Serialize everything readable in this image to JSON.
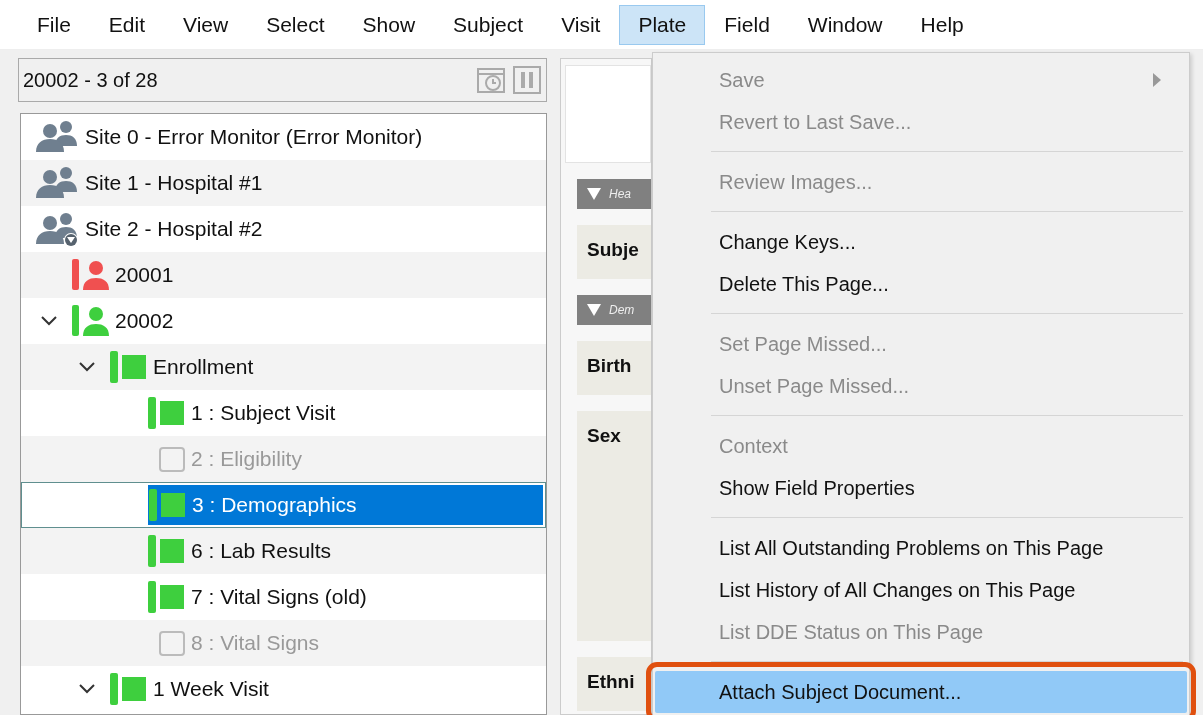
{
  "menubar": [
    {
      "label": "File",
      "selected": false
    },
    {
      "label": "Edit",
      "selected": false
    },
    {
      "label": "View",
      "selected": false
    },
    {
      "label": "Select",
      "selected": false
    },
    {
      "label": "Show",
      "selected": false
    },
    {
      "label": "Subject",
      "selected": false
    },
    {
      "label": "Visit",
      "selected": false
    },
    {
      "label": "Plate",
      "selected": true
    },
    {
      "label": "Field",
      "selected": false
    },
    {
      "label": "Window",
      "selected": false
    },
    {
      "label": "Help",
      "selected": false
    }
  ],
  "navigator": {
    "position": "20002 - 3 of 28"
  },
  "tree": [
    {
      "kind": "site",
      "label": "Site 0 - Error Monitor (Error Monitor)",
      "filtered": false,
      "selected": false
    },
    {
      "kind": "site",
      "label": "Site 1 - Hospital #1",
      "filtered": false,
      "selected": false
    },
    {
      "kind": "site",
      "label": "Site 2 - Hospital #2",
      "filtered": true,
      "selected": false,
      "children": [
        {
          "kind": "subject",
          "label": "20001",
          "color": "#f05050",
          "selected": false
        },
        {
          "kind": "subject",
          "label": "20002",
          "color": "#3ecf3e",
          "expanded": true,
          "selected": false,
          "children": [
            {
              "kind": "visit",
              "label": "Enrollment",
              "color": "#3ecf3e",
              "expanded": true,
              "selected": false,
              "children": [
                {
                  "kind": "page",
                  "label": "1 : Subject Visit",
                  "color": "#3ecf3e",
                  "missing": false,
                  "selected": false
                },
                {
                  "kind": "page",
                  "label": "2 : Eligibility",
                  "missing": true,
                  "selected": false
                },
                {
                  "kind": "page",
                  "label": "3 : Demographics",
                  "color": "#3ecf3e",
                  "missing": false,
                  "selected": true
                },
                {
                  "kind": "page",
                  "label": "6 : Lab Results",
                  "color": "#3ecf3e",
                  "missing": false,
                  "selected": false
                },
                {
                  "kind": "page",
                  "label": "7 : Vital Signs (old)",
                  "color": "#3ecf3e",
                  "missing": false,
                  "selected": false
                },
                {
                  "kind": "page",
                  "label": "8 : Vital Signs",
                  "missing": true,
                  "selected": false
                }
              ]
            },
            {
              "kind": "visit",
              "label": "1 Week Visit",
              "color": "#3ecf3e",
              "expanded": true,
              "selected": false
            }
          ]
        }
      ]
    }
  ],
  "form": {
    "sections": [
      {
        "title": "Hea",
        "fields": [
          {
            "label": "Subje",
            "kind": "text"
          }
        ]
      },
      {
        "title": "Dem",
        "fields": [
          {
            "label": "Birth",
            "kind": "text"
          },
          {
            "label": "Sex",
            "kind": "choice"
          },
          {
            "label": "Ethni",
            "kind": "text"
          }
        ]
      }
    ]
  },
  "plate_menu": [
    {
      "kind": "item",
      "label": "Save",
      "disabled": true,
      "submenu": true,
      "selected": false,
      "outlined": false
    },
    {
      "kind": "item",
      "label": "Revert to Last Save...",
      "disabled": true,
      "submenu": false,
      "selected": false,
      "outlined": false
    },
    {
      "kind": "separator"
    },
    {
      "kind": "item",
      "label": "Review Images...",
      "disabled": true,
      "submenu": false,
      "selected": false,
      "outlined": false
    },
    {
      "kind": "separator"
    },
    {
      "kind": "item",
      "label": "Change Keys...",
      "disabled": false,
      "submenu": false,
      "selected": false,
      "outlined": false
    },
    {
      "kind": "item",
      "label": "Delete This Page...",
      "disabled": false,
      "submenu": false,
      "selected": false,
      "outlined": false
    },
    {
      "kind": "separator"
    },
    {
      "kind": "item",
      "label": "Set Page Missed...",
      "disabled": true,
      "submenu": false,
      "selected": false,
      "outlined": false
    },
    {
      "kind": "item",
      "label": "Unset Page Missed...",
      "disabled": true,
      "submenu": false,
      "selected": false,
      "outlined": false
    },
    {
      "kind": "separator"
    },
    {
      "kind": "item",
      "label": "Context",
      "disabled": true,
      "submenu": false,
      "selected": false,
      "outlined": false
    },
    {
      "kind": "item",
      "label": "Show Field Properties",
      "disabled": false,
      "submenu": false,
      "selected": false,
      "outlined": false
    },
    {
      "kind": "separator"
    },
    {
      "kind": "item",
      "label": "List All Outstanding Problems on This Page",
      "disabled": false,
      "submenu": false,
      "selected": false,
      "outlined": false
    },
    {
      "kind": "item",
      "label": "List History of All Changes on This Page",
      "disabled": false,
      "submenu": false,
      "selected": false,
      "outlined": false
    },
    {
      "kind": "item",
      "label": "List DDE Status on This Page",
      "disabled": true,
      "submenu": false,
      "selected": false,
      "outlined": false
    },
    {
      "kind": "separator"
    },
    {
      "kind": "item",
      "label": "Attach Subject Document...",
      "disabled": false,
      "submenu": false,
      "selected": true,
      "outlined": true
    }
  ]
}
